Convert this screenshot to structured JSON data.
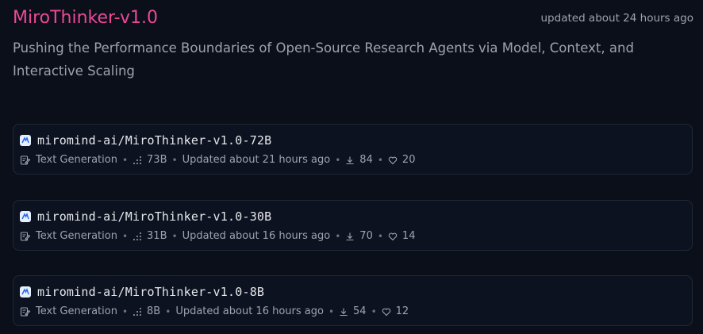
{
  "collection": {
    "title": "MiroThinker-v1.0",
    "updated": "updated about 24 hours ago",
    "description": "Pushing the Performance Boundaries of Open-Source Research Agents via Model, Context, and Interactive Scaling"
  },
  "models": [
    {
      "name": "miromind-ai/MiroThinker-v1.0-72B",
      "task": "Text Generation",
      "params": "73B",
      "updated": "Updated about 21 hours ago",
      "downloads": "84",
      "likes": "20"
    },
    {
      "name": "miromind-ai/MiroThinker-v1.0-30B",
      "task": "Text Generation",
      "params": "31B",
      "updated": "Updated about 16 hours ago",
      "downloads": "70",
      "likes": "14"
    },
    {
      "name": "miromind-ai/MiroThinker-v1.0-8B",
      "task": "Text Generation",
      "params": "8B",
      "updated": "Updated about 16 hours ago",
      "downloads": "54",
      "likes": "12"
    }
  ],
  "colors": {
    "background": "#0b0f19",
    "title": "#ec4899",
    "muted_text": "#9ca3af",
    "card_border": "#1f2937"
  },
  "icons": {
    "org_avatar": "miromind-logo-icon",
    "task": "text-generation-icon",
    "params": "parameters-icon",
    "downloads": "download-icon",
    "likes": "heart-icon"
  }
}
